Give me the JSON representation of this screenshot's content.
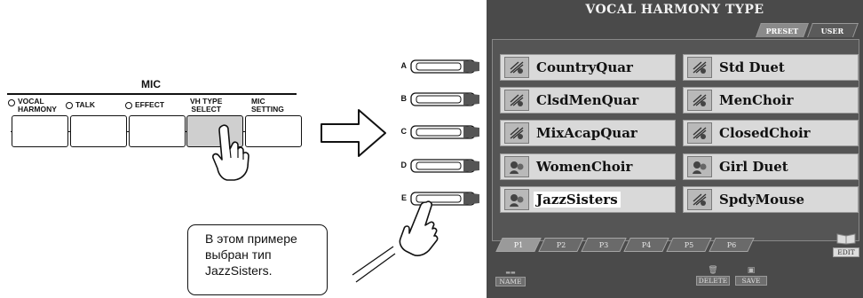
{
  "mic_panel": {
    "title": "MIC",
    "buttons": [
      {
        "label_line1": "VOCAL",
        "label_line2": "HARMONY",
        "has_led": true
      },
      {
        "label_line1": "TALK",
        "label_line2": "",
        "has_led": true
      },
      {
        "label_line1": "EFFECT",
        "label_line2": "",
        "has_led": true
      },
      {
        "label_line1": "VH TYPE",
        "label_line2": "SELECT",
        "has_led": false,
        "pressed": true
      },
      {
        "label_line1": "MIC",
        "label_line2": "SETTING",
        "has_led": false
      }
    ]
  },
  "side_buttons": [
    "A",
    "B",
    "C",
    "D",
    "E"
  ],
  "lcd": {
    "title": "VOCAL HARMONY TYPE",
    "top_tabs": [
      {
        "label": "PRESET",
        "active": true
      },
      {
        "label": "USER",
        "active": false
      }
    ],
    "items_left": [
      "CountryQuar",
      "ClsdMenQuar",
      "MixAcapQuar",
      "WomenChoir",
      "JazzSisters"
    ],
    "items_right": [
      "Std Duet",
      "MenChoir",
      "ClosedChoir",
      "Girl Duet",
      "SpdyMouse"
    ],
    "selected_item": "JazzSisters",
    "page_tabs": [
      "P1",
      "P2",
      "P3",
      "P4",
      "P5",
      "P6"
    ],
    "active_page": "P1",
    "bottom_buttons": {
      "name": "NAME",
      "delete": "DELETE",
      "save": "SAVE",
      "edit": "EDIT"
    },
    "colors": {
      "background": "#4a4a4a",
      "item": "#d9d9d9",
      "selected_highlight": "#ffffff"
    }
  },
  "callout": {
    "line1": "В этом примере",
    "line2": "выбран тип",
    "line3": "JazzSisters."
  }
}
